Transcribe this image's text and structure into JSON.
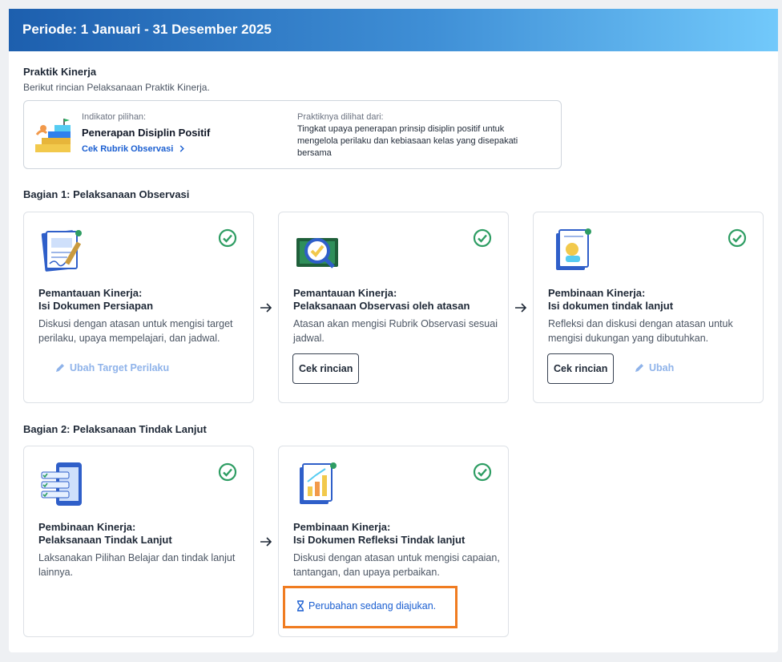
{
  "header": {
    "title": "Periode: 1 Januari - 31 Desember 2025"
  },
  "praktik": {
    "title": "Praktik Kinerja",
    "subtitle": "Berikut rincian Pelaksanaan Praktik Kinerja.",
    "indicator_label": "Indikator pilihan:",
    "indicator_value": "Penerapan Disiplin Positif",
    "rubric_link": "Cek Rubrik Observasi",
    "seen_label": "Praktiknya dilihat dari:",
    "seen_text": "Tingkat upaya penerapan prinsip disiplin positif untuk mengelola perilaku dan kebiasaan kelas yang disepakati bersama"
  },
  "bagian1": {
    "title": "Bagian 1: Pelaksanaan Observasi",
    "cards": [
      {
        "title_line1": "Pemantauan Kinerja:",
        "title_line2": "Isi Dokumen Persiapan",
        "desc": "Diskusi dengan atasan untuk mengisi target perilaku, upaya mempelajari, dan jadwal.",
        "link": "Ubah Target Perilaku"
      },
      {
        "title_line1": "Pemantauan Kinerja:",
        "title_line2": "Pelaksanaan Observasi oleh atasan",
        "desc": "Atasan akan mengisi Rubrik Observasi sesuai jadwal.",
        "button": "Cek rincian"
      },
      {
        "title_line1": "Pembinaan Kinerja:",
        "title_line2": "Isi dokumen tindak lanjut",
        "desc": "Refleksi dan diskusi dengan atasan untuk mengisi dukungan yang dibutuhkan.",
        "button": "Cek rincian",
        "link": "Ubah"
      }
    ]
  },
  "bagian2": {
    "title": "Bagian 2: Pelaksanaan Tindak Lanjut",
    "cards": [
      {
        "title_line1": "Pembinaan Kinerja:",
        "title_line2": "Pelaksanaan Tindak Lanjut",
        "desc": "Laksanakan Pilihan Belajar dan tindak lanjut lainnya."
      },
      {
        "title_line1": "Pembinaan Kinerja:",
        "title_line2": "Isi Dokumen Refleksi Tindak lanjut",
        "desc": "Diskusi dengan atasan untuk mengisi capaian, tantangan, dan upaya perbaikan.",
        "status": "Perubahan sedang diajukan."
      }
    ]
  },
  "colors": {
    "header_start": "#1d5fae",
    "header_end": "#72c9fb",
    "check": "#2e9d63",
    "link": "#1b5fd1",
    "highlight": "#f07c21"
  }
}
